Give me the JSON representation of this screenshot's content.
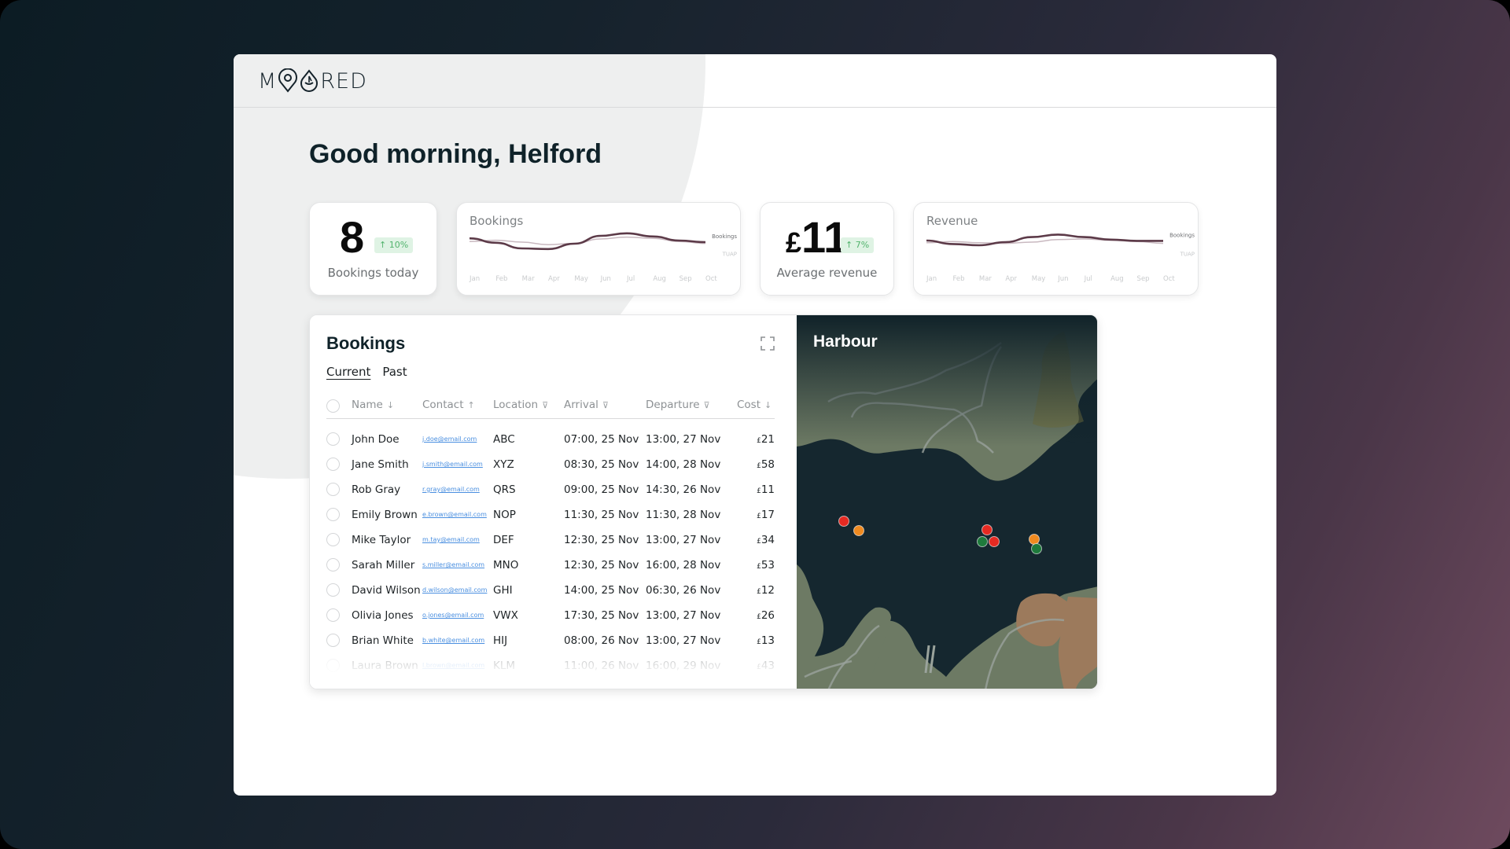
{
  "app": {
    "brand": "MOORED"
  },
  "greeting": "Good morning, Helford",
  "stats": [
    {
      "value": "8",
      "currency": "",
      "change": "↑ 10%",
      "label": "Bookings today"
    },
    {
      "value": "11",
      "currency": "£",
      "change": "↑ 7%",
      "label": "Average revenue"
    }
  ],
  "colors": {
    "accent": "#5c3a48",
    "secondary_line": "#c9b9c0",
    "badge_bg": "#dff3e4",
    "badge_text": "#52b36d",
    "link": "#4a8fe0",
    "water": "#15272f",
    "land": "#6d7a64",
    "fields": "#9c7a5c",
    "pin_red": "#e52a22",
    "pin_orange": "#ef8a20",
    "pin_green": "#1e7a3c"
  },
  "chart_data": [
    {
      "type": "line",
      "title": "Bookings",
      "categories": [
        "Jan",
        "Feb",
        "Mar",
        "Apr",
        "May",
        "Jun",
        "Jul",
        "Aug",
        "Sep",
        "Oct"
      ],
      "series": [
        {
          "name": "Bookings",
          "values": [
            62,
            48,
            30,
            28,
            45,
            70,
            78,
            68,
            55,
            50
          ]
        },
        {
          "name": "TUAP",
          "values": [
            52,
            56,
            50,
            42,
            46,
            60,
            66,
            62,
            52,
            46
          ]
        }
      ],
      "ylim": [
        0,
        100
      ],
      "grid": false,
      "legend": "right-inline"
    },
    {
      "type": "line",
      "title": "Revenue",
      "categories": [
        "Jan",
        "Feb",
        "Mar",
        "Apr",
        "May",
        "Jun",
        "Jul",
        "Aug",
        "Sep",
        "Oct"
      ],
      "series": [
        {
          "name": "Bookings",
          "values": [
            55,
            44,
            40,
            50,
            66,
            74,
            66,
            58,
            54,
            54
          ]
        },
        {
          "name": "TUAP",
          "values": [
            48,
            52,
            48,
            46,
            50,
            58,
            60,
            56,
            52,
            46
          ]
        }
      ],
      "ylim": [
        0,
        100
      ],
      "grid": false,
      "legend": "right-inline"
    }
  ],
  "bookings": {
    "title": "Bookings",
    "expand_icon": "expand-icon",
    "tabs": [
      {
        "label": "Current",
        "active": true
      },
      {
        "label": "Past",
        "active": false
      }
    ],
    "columns": [
      {
        "label": "Name",
        "icon": "↓"
      },
      {
        "label": "Contact",
        "icon": "↑"
      },
      {
        "label": "Location",
        "icon": "⊽"
      },
      {
        "label": "Arrival",
        "icon": "⊽"
      },
      {
        "label": "Departure",
        "icon": "⊽"
      },
      {
        "label": "Cost",
        "icon": "↓"
      }
    ],
    "rows": [
      {
        "name": "John Doe",
        "contact": "j.doe@email.com",
        "location": "ABC",
        "arrival": "07:00, 25 Nov",
        "departure": "13:00, 27 Nov",
        "cost": "21"
      },
      {
        "name": "Jane Smith",
        "contact": "j.smith@email.com",
        "location": "XYZ",
        "arrival": "08:30, 25 Nov",
        "departure": "14:00, 28 Nov",
        "cost": "58"
      },
      {
        "name": "Rob Gray",
        "contact": "r.gray@email.com",
        "location": "QRS",
        "arrival": "09:00, 25 Nov",
        "departure": "14:30, 26 Nov",
        "cost": "11"
      },
      {
        "name": "Emily Brown",
        "contact": "e.brown@email.com",
        "location": "NOP",
        "arrival": "11:30, 25 Nov",
        "departure": "11:30, 28 Nov",
        "cost": "17"
      },
      {
        "name": "Mike Taylor",
        "contact": "m.tay@email.com",
        "location": "DEF",
        "arrival": "12:30, 25 Nov",
        "departure": "13:00, 27 Nov",
        "cost": "34"
      },
      {
        "name": "Sarah Miller",
        "contact": "s.miller@email.com",
        "location": "MNO",
        "arrival": "12:30, 25 Nov",
        "departure": "16:00, 28 Nov",
        "cost": "53"
      },
      {
        "name": "David Wilson",
        "contact": "d.wilson@email.com",
        "location": "GHI",
        "arrival": "14:00, 25 Nov",
        "departure": "06:30, 26 Nov",
        "cost": "12"
      },
      {
        "name": "Olivia Jones",
        "contact": "o.jones@email.com",
        "location": "VWX",
        "arrival": "17:30, 25 Nov",
        "departure": "13:00, 27 Nov",
        "cost": "26"
      },
      {
        "name": "Brian White",
        "contact": "b.white@email.com",
        "location": "HIJ",
        "arrival": "08:00, 26 Nov",
        "departure": "13:00, 27 Nov",
        "cost": "13"
      },
      {
        "name": "Laura Brown",
        "contact": "l.brown@email.com",
        "location": "KLM",
        "arrival": "11:00, 26 Nov",
        "departure": "16:00, 29 Nov",
        "cost": "43"
      }
    ],
    "currency": "£"
  },
  "map": {
    "title": "Harbour",
    "pins": [
      {
        "status": "red"
      },
      {
        "status": "orange"
      },
      {
        "status": "red"
      },
      {
        "status": "green"
      },
      {
        "status": "red"
      },
      {
        "status": "orange"
      },
      {
        "status": "green"
      }
    ]
  }
}
